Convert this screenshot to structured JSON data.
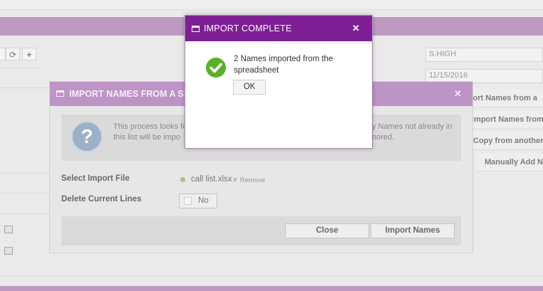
{
  "background": {
    "toolbar": {
      "refresh_icon": "refresh-icon",
      "add_icon": "+"
    },
    "right_panel": {
      "user_field": "S.HIGH",
      "date_field": "11/15/2016",
      "buttons": [
        "Import Names from a",
        "Import Names from",
        "Copy from another",
        "Manually Add N"
      ]
    }
  },
  "import_dialog": {
    "title": "IMPORT NAMES FROM A SP",
    "info_line1_left": "This process looks fo",
    "info_line1_right": "y Names not already in",
    "info_line2_left": "this list will be impo",
    "info_line2_right": "nored.",
    "select_file_label": "Select Import File",
    "file_name": "call list.xlsx",
    "remove_label": "Remove",
    "delete_lines_label": "Delete Current Lines",
    "delete_lines_value": "No",
    "close_label": "Close",
    "import_label": "Import Names"
  },
  "complete_modal": {
    "title": "IMPORT COMPLETE",
    "close_symbol": "✕",
    "message": "2 Names imported from the spreadsheet",
    "ok_label": "OK"
  },
  "colors": {
    "modal_header": "#7e1e95",
    "dialog_header_dimmed": "#b586c0",
    "success": "#5ab02a"
  }
}
